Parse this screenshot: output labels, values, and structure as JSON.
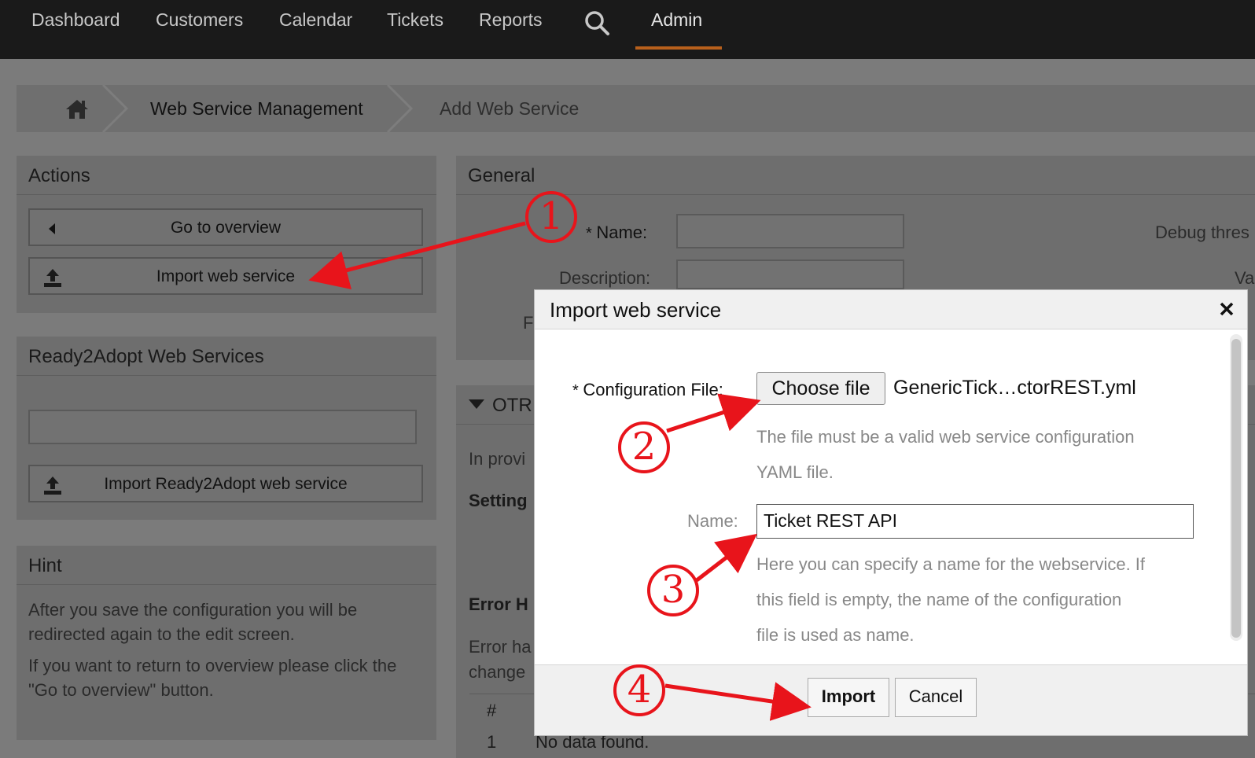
{
  "nav": {
    "items": [
      "Dashboard",
      "Customers",
      "Calendar",
      "Tickets",
      "Reports"
    ],
    "active": "Admin"
  },
  "breadcrumb": {
    "level1": "Web Service Management",
    "level2": "Add Web Service"
  },
  "actions": {
    "title": "Actions",
    "go_overview": "Go to overview",
    "import_ws": "Import web service"
  },
  "ready2adopt": {
    "title": "Ready2Adopt Web Services",
    "import_btn": "Import Ready2Adopt web service"
  },
  "hint": {
    "title": "Hint",
    "p1": "After you save the configuration you will be redirected again to the edit screen.",
    "p2": "If you want to return to overview please click the \"Go to overview\" button."
  },
  "general": {
    "title": "General",
    "name_label": "Name:",
    "desc_label": "Description:",
    "debug_label": "Debug thres",
    "valid_label": "Va",
    "cut_f": "F",
    "otr": "OTR",
    "in_prov": "In provi",
    "setting": "Setting",
    "error_h": "Error H",
    "error_ha": "Error ha",
    "change": "change",
    "table_hash": "#",
    "row_num": "1",
    "no_data": "No data found."
  },
  "modal": {
    "title": "Import web service",
    "config_label": "Configuration File:",
    "choose_file": "Choose file",
    "file_name": "GenericTick…ctorREST.yml",
    "config_help_1": "The file must be a valid web service configuration",
    "config_help_2": "YAML file.",
    "name_label": "Name:",
    "name_value": "Ticket REST API",
    "name_help_1": "Here you can specify a name for the webservice. If",
    "name_help_2": "this field is empty, the name of the configuration",
    "name_help_3": "file is used as name.",
    "import_btn": "Import",
    "cancel_btn": "Cancel"
  },
  "callouts": [
    "1",
    "2",
    "3",
    "4"
  ],
  "colors": {
    "accent": "#b8601c",
    "annotation": "#e8141b"
  }
}
